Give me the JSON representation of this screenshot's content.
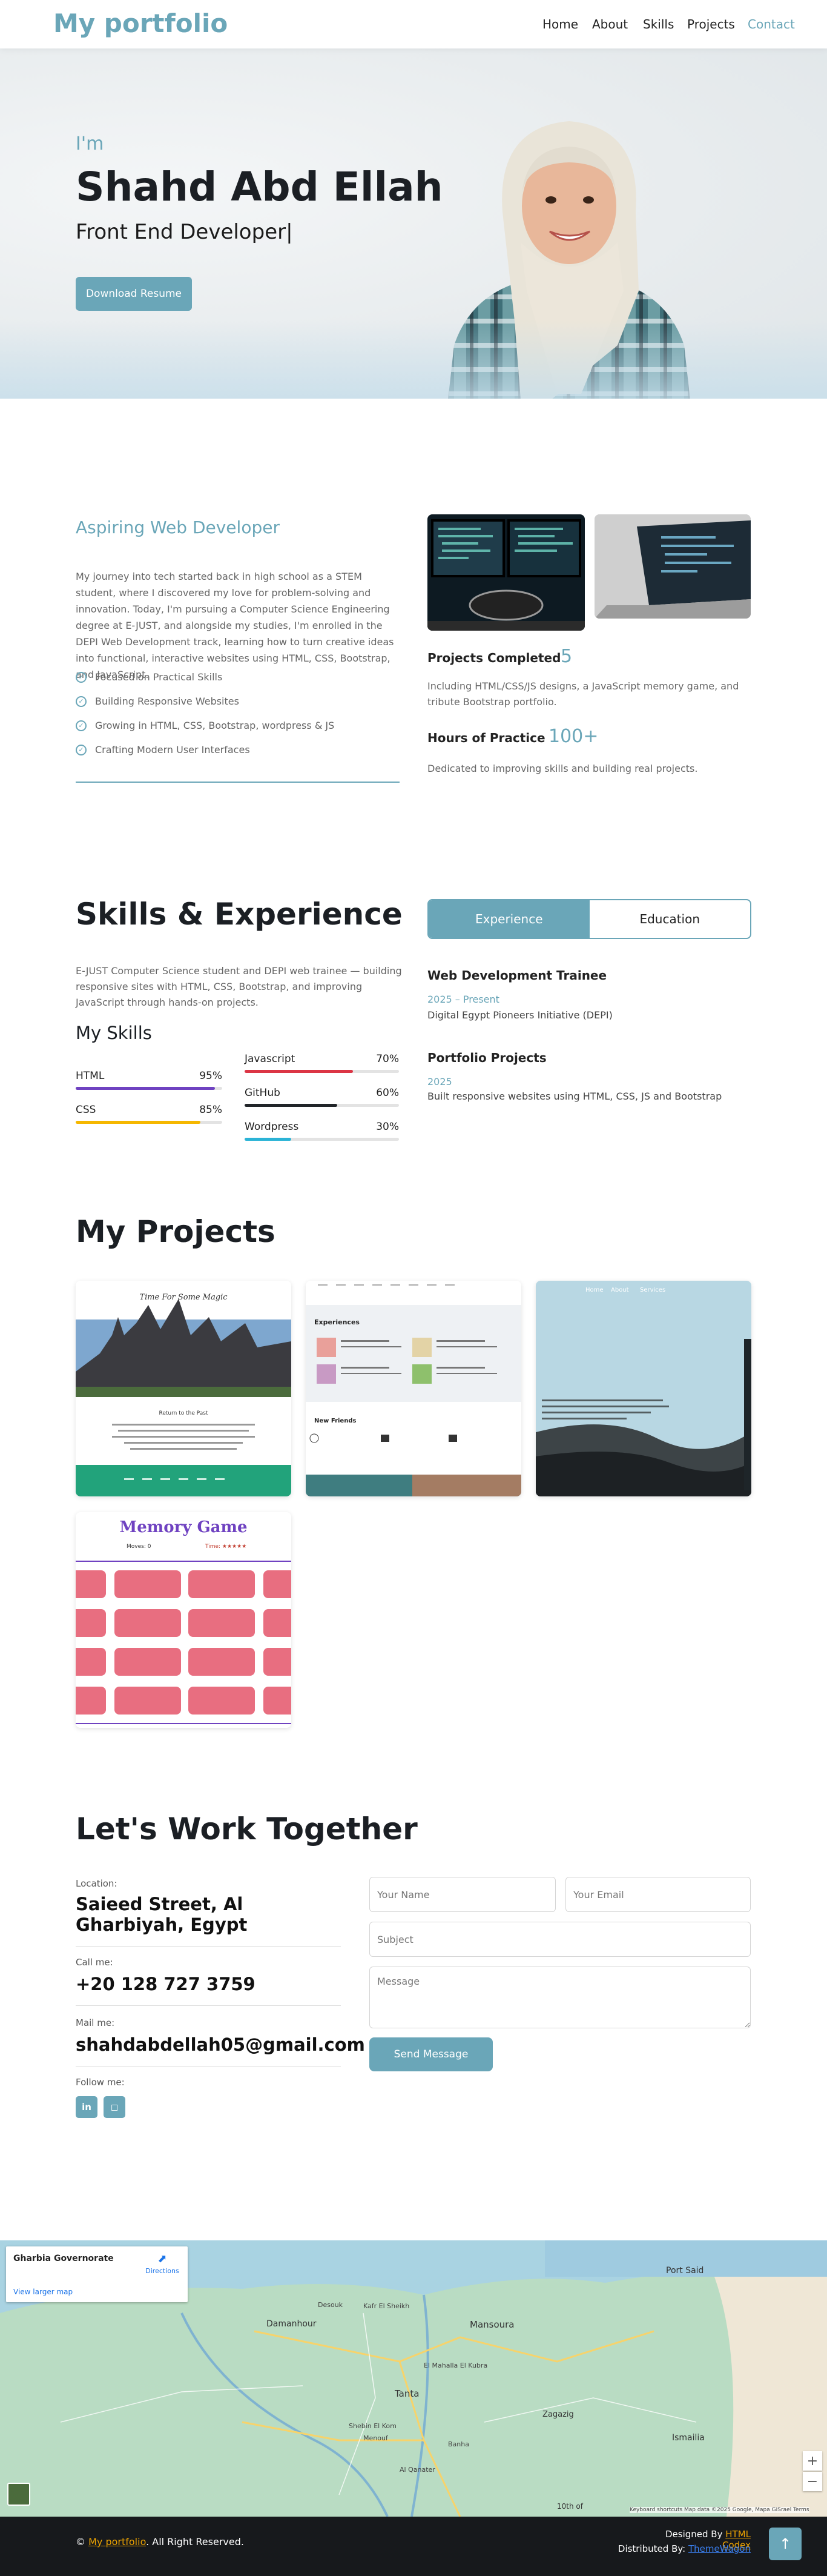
{
  "colors": {
    "accent": "#6aa6b8",
    "dark": "#1b1f24",
    "footer_bg": "#17191c",
    "footer_link": "#f0a500"
  },
  "nav": {
    "brand": "My portfolio",
    "links": [
      {
        "label": "Home",
        "active": false
      },
      {
        "label": "About",
        "active": false
      },
      {
        "label": "Skills",
        "active": false
      },
      {
        "label": "Projects",
        "active": false
      },
      {
        "label": "Contact",
        "active": true
      }
    ]
  },
  "hero": {
    "greeting": "I'm",
    "name": "Shahd Abd Ellah",
    "role": "Front End Developer|",
    "button": "Download Resume"
  },
  "about": {
    "title": "Aspiring Web Developer",
    "text": "My journey into tech started back in high school as a STEM student, where I discovered my love for problem-solving and innovation. Today, I'm pursuing a Computer Science Engineering degree at E-JUST, and alongside my studies, I'm enrolled in the DEPI Web Development track, learning how to turn creative ideas into functional, interactive websites using HTML, CSS, Bootstrap, and JavaScript.",
    "list": [
      "Focused on Practical Skills",
      "Building Responsive Websites",
      "Growing in HTML, CSS, Bootstrap, wordpress & JS",
      "Crafting Modern User Interfaces"
    ],
    "projects_label": "Projects Completed",
    "projects_value": "5",
    "projects_desc": "Including HTML/CSS/JS designs, a JavaScript memory game, and tribute Bootstrap portfolio.",
    "hours_label": "Hours of Practice",
    "hours_value": "100+",
    "hours_desc": "Dedicated to improving skills and building real projects."
  },
  "skills": {
    "title": "Skills & Experience",
    "desc": "E-JUST Computer Science student and DEPI web trainee — building responsive sites with HTML, CSS, Bootstrap, and improving JavaScript through hands-on projects.",
    "my_skills_title": "My Skills",
    "items": [
      {
        "name": "HTML",
        "pct": "95%",
        "value": 95,
        "color": "#6f42c1"
      },
      {
        "name": "CSS",
        "pct": "85%",
        "value": 85,
        "color": "#f5b700"
      },
      {
        "name": "Javascript",
        "pct": "70%",
        "value": 70,
        "color": "#dc3545"
      },
      {
        "name": "GitHub",
        "pct": "60%",
        "value": 60,
        "color": "#212529"
      },
      {
        "name": "Wordpress",
        "pct": "30%",
        "value": 30,
        "color": "#2bb3d6"
      }
    ],
    "tabs": [
      {
        "label": "Experience",
        "active": true
      },
      {
        "label": "Education",
        "active": false
      }
    ],
    "experience": [
      {
        "title": "Web Development Trainee",
        "date": "2025 – Present",
        "org": "Digital Egypt Pioneers Initiative (DEPI)"
      },
      {
        "title": "Portfolio Projects",
        "date": "2025",
        "org": "Built responsive websites using HTML, CSS, JS and Bootstrap"
      }
    ]
  },
  "projects": {
    "title": "My Projects",
    "p1": {
      "heading": "Time For Some Magic",
      "caption": "Return to the Past"
    },
    "p2": {
      "heading": "Experiences",
      "sub": "New Friends"
    },
    "p3": {
      "nav": [
        "Home",
        "About",
        "Services"
      ]
    },
    "p4": {
      "heading": "Memory Game",
      "moves": "Moves: 0",
      "timer": "Time: ★★★★★"
    }
  },
  "contact": {
    "title": "Let's Work Together",
    "location_label": "Location:",
    "location": "Saieed Street, Al Gharbiyah, Egypt",
    "call_label": "Call me:",
    "phone": "+20 128 727 3759",
    "mail_label": "Mail me:",
    "email": "shahdabdellah05@gmail.com",
    "follow_label": "Follow me:",
    "social": [
      {
        "icon": "linkedin-icon",
        "glyph": "in"
      },
      {
        "icon": "instagram-icon",
        "glyph": "◻"
      }
    ],
    "form": {
      "name_ph": "Your Name",
      "email_ph": "Your Email",
      "subject_ph": "Subject",
      "message_ph": "Message",
      "send": "Send Message"
    }
  },
  "map": {
    "place": "Gharbia Governorate",
    "larger": "View larger map",
    "directions": "Directions",
    "labels": [
      "Port Said",
      "Damanhour",
      "Mansoura",
      "Tanta",
      "Zagazig",
      "Ismailia",
      "Kafr El Sheikh",
      "Desouk",
      "Menouf",
      "Shebin El Kom",
      "El Mahalla El Kubra",
      "Al Qanater",
      "Banha",
      "10th of"
    ],
    "attribution": "Keyboard shortcuts   Map data ©2025 Google, Mapa GISrael   Terms"
  },
  "footer": {
    "copyright_prefix": "©",
    "site": "My portfolio",
    "rights": ". All Right Reserved.",
    "designed_prefix": "Designed By",
    "designed_by": "HTML Codex",
    "distributed_prefix": "Distributed By:",
    "distributed_by": "ThemeWagon"
  }
}
